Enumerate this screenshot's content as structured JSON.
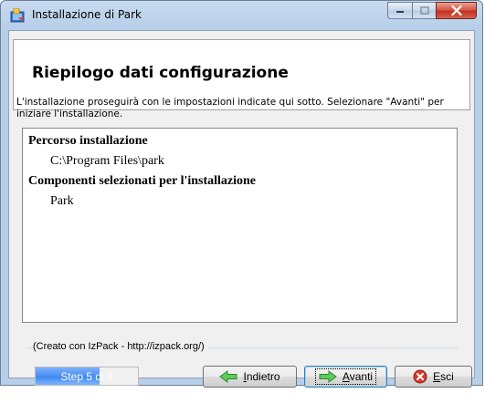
{
  "window": {
    "title": "Installazione di  Park"
  },
  "header": {
    "title": "Riepilogo dati configurazione"
  },
  "intro_text": "L'installazione proseguirà con le impostazioni indicate qui sotto. Selezionare \"Avanti\" per iniziare l'installazione.",
  "summary": {
    "sections": [
      {
        "title": "Percorso installazione",
        "value": "C:\\Program Files\\park"
      },
      {
        "title": "Componenti selezionati per l'installazione",
        "value": "Park"
      }
    ]
  },
  "footer": {
    "credit": "(Creato con IzPack - http://izpack.org/)"
  },
  "progress": {
    "label": "Step 5 di 8",
    "current": 5,
    "total": 8
  },
  "buttons": {
    "back": "Indietro",
    "next": "Avanti",
    "quit": "Esci"
  },
  "icons": {
    "app": "installer-icon",
    "back": "arrow-left-icon",
    "next": "arrow-right-icon",
    "quit": "close-circle-icon"
  },
  "colors": {
    "accent_green": "#3cb843",
    "close_red": "#c1311f",
    "progress_blue": "#3c86f0"
  }
}
